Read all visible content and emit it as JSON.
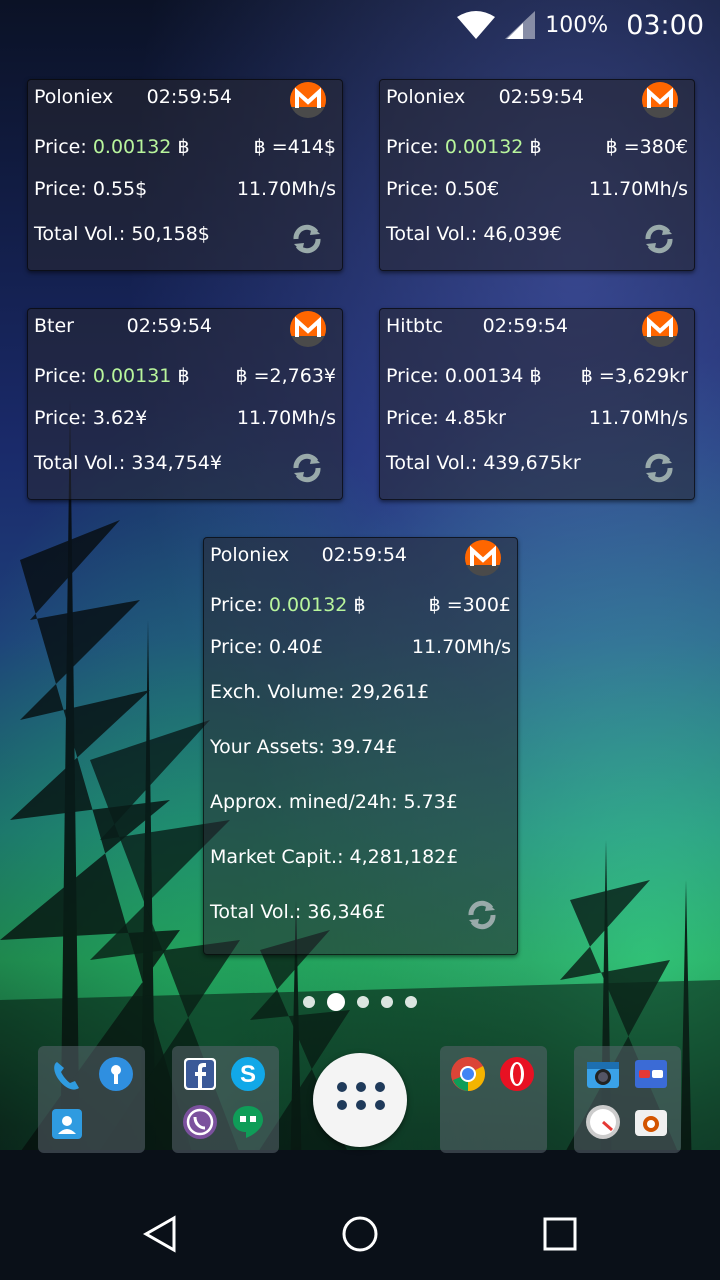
{
  "status_bar": {
    "battery": "100%",
    "time": "03:00"
  },
  "widgets": [
    {
      "exchange": "Poloniex",
      "time": "02:59:54",
      "btc_price": "0.00132",
      "btc_rate": "=414$",
      "price": "0.55$",
      "hashrate": "11.70Mh/s",
      "total_vol": "50,158$",
      "price_green": true
    },
    {
      "exchange": "Poloniex",
      "time": "02:59:54",
      "btc_price": "0.00132",
      "btc_rate": "=380€",
      "price": "0.50€",
      "hashrate": "11.70Mh/s",
      "total_vol": "46,039€",
      "price_green": true
    },
    {
      "exchange": "Bter",
      "time": "02:59:54",
      "btc_price": "0.00131",
      "btc_rate": "=2,763¥",
      "price": "3.62¥",
      "hashrate": "11.70Mh/s",
      "total_vol": "334,754¥",
      "price_green": true
    },
    {
      "exchange": "Hitbtc",
      "time": "02:59:54",
      "btc_price": "0.00134",
      "btc_rate": "=3,629kr",
      "price": "4.85kr",
      "hashrate": "11.70Mh/s",
      "total_vol": "439,675kr",
      "price_green": false
    }
  ],
  "big_widget": {
    "exchange": "Poloniex",
    "time": "02:59:54",
    "btc_price": "0.00132",
    "btc_rate": "=300£",
    "price": "0.40£",
    "hashrate": "11.70Mh/s",
    "exch_volume": "29,261£",
    "your_assets": "39.74£",
    "mined_24h": "5.73£",
    "market_cap": "4,281,182£",
    "total_vol": "36,346£"
  },
  "labels": {
    "price": "Price:",
    "total_vol": "Total Vol.:",
    "exch_volume": "Exch. Volume:",
    "your_assets": "Your Assets:",
    "mined_24h": "Approx. mined/24h:",
    "market_cap": "Market Capit.:",
    "btc_symbol": "฿"
  },
  "pager": {
    "pages": 5,
    "active_index": 1
  },
  "dock": {
    "folders": [
      {
        "apps": [
          "phone-icon",
          "keyhole-app-icon",
          "contacts-icon"
        ]
      },
      {
        "apps": [
          "facebook-icon",
          "skype-icon",
          "viber-icon",
          "hangouts-icon"
        ]
      },
      {
        "apps": [
          "chrome-icon",
          "opera-icon"
        ]
      },
      {
        "apps": [
          "camera-icon",
          "glasses-app-icon",
          "speedometer-icon",
          "camera-alt-icon"
        ]
      }
    ],
    "all_apps_icon": "app-drawer-icon"
  },
  "nav": {
    "back": "back-icon",
    "home": "home-icon",
    "recents": "recents-icon"
  },
  "colors": {
    "price_green": "#b8f59c",
    "monero_orange": "#ff6600",
    "monero_gray": "#4a4a4a"
  }
}
